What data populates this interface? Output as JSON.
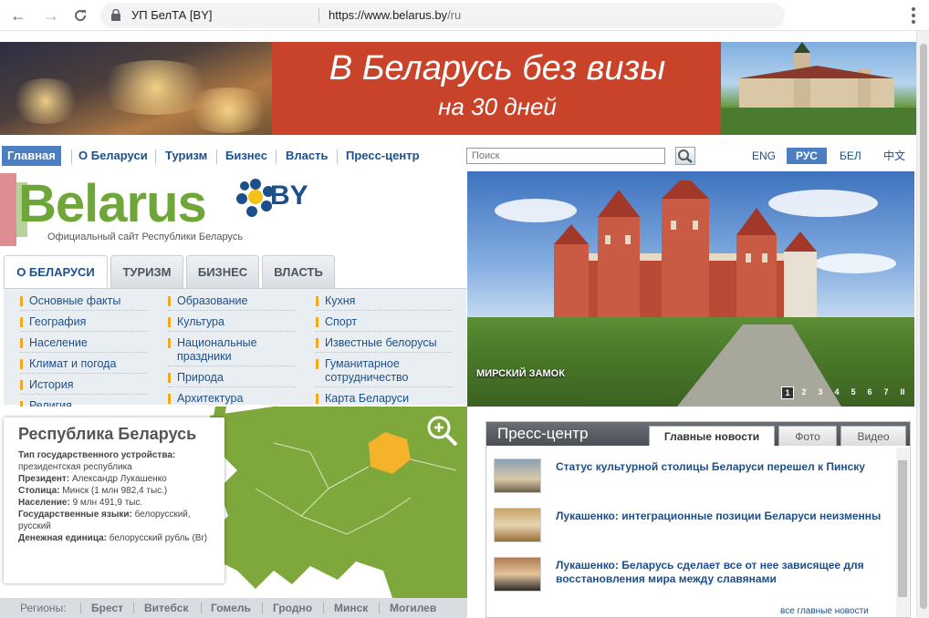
{
  "browser": {
    "site_name": "УП БелТА [BY]",
    "url_host": "https://www.belarus.by",
    "url_path": "/ru"
  },
  "banner": {
    "line1": "В Беларусь без визы",
    "line2": "на 30 дней"
  },
  "topnav": [
    "Главная",
    "О Беларуси",
    "Туризм",
    "Бизнес",
    "Власть",
    "Пресс-центр"
  ],
  "search": {
    "placeholder": "Поиск"
  },
  "languages": [
    "ENG",
    "РУС",
    "БЕЛ",
    "中文"
  ],
  "logo": {
    "word": "Belarus",
    "by": "BY",
    "subtitle": "Официальный сайт Республики Беларусь"
  },
  "left_tabs": [
    "О БЕЛАРУСИ",
    "ТУРИЗМ",
    "БИЗНЕС",
    "ВЛАСТЬ"
  ],
  "about_links": {
    "col1": [
      "Основные факты",
      "География",
      "Население",
      "Климат и погода",
      "История",
      "Религия"
    ],
    "col2": [
      "Образование",
      "Культура",
      "Национальные праздники",
      "Природа",
      "Архитектура"
    ],
    "col3": [
      "Кухня",
      "Спорт",
      "Известные белорусы",
      "Гуманитарное сотрудничество",
      "Карта Беларуси"
    ]
  },
  "slider": {
    "caption": "МИРСКИЙ ЗАМОК",
    "pages": [
      "1",
      "2",
      "3",
      "4",
      "5",
      "6",
      "7"
    ],
    "pause": "II"
  },
  "info": {
    "title": "Республика Беларусь",
    "government_label": "Тип государственного устройства:",
    "government_value": "президентская республика",
    "president_label": "Президент:",
    "president_value": "Александр Лукашенко",
    "capital_label": "Столица:",
    "capital_value": "Минск (1 млн 982,4 тыс.)",
    "population_label": "Население:",
    "population_value": "9 млн 491,9 тыс.",
    "languages_label": "Государственные языки:",
    "languages_value": "белорусский, русский",
    "currency_label": "Денежная единица:",
    "currency_value": "белорусский рубль (Br)"
  },
  "regions": {
    "label": "Регионы:",
    "items": [
      "Брест",
      "Витебск",
      "Гомель",
      "Гродно",
      "Минск",
      "Могилев"
    ]
  },
  "press": {
    "title": "Пресс-центр",
    "tabs": [
      "Главные новости",
      "Фото",
      "Видео"
    ],
    "news": [
      "Статус культурной столицы Беларуси перешел к Пинску",
      "Лукашенко: интеграционные позиции Беларуси неизменны",
      "Лукашенко: Беларусь сделает все от нее зависящее для восстановления мира между славянами"
    ],
    "more": "все главные новости"
  },
  "colors": {
    "link_blue": "#1d4f8a",
    "active_blue": "#4c7fc2",
    "banner_red": "#c9432a",
    "map_green": "#7fa83c",
    "belarus_highlight": "#f4b32a"
  }
}
